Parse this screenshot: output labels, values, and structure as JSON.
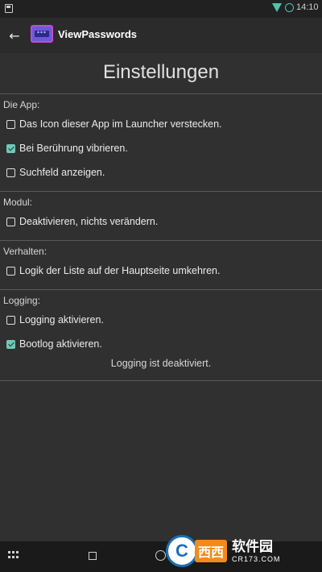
{
  "status_bar": {
    "time": "14:10",
    "icons": [
      "notification-icon",
      "wifi-icon",
      "sync-icon"
    ]
  },
  "app_bar": {
    "back_icon": "arrow-left-icon",
    "logo_icon": "password-app-logo-icon",
    "logo_text": "***",
    "title": "ViewPasswords"
  },
  "page": {
    "title": "Einstellungen"
  },
  "sections": {
    "app": {
      "label": "Die App:",
      "items": [
        {
          "label": "Das Icon dieser App im Launcher verstecken.",
          "checked": false
        },
        {
          "label": "Bei Berührung vibrieren.",
          "checked": true
        },
        {
          "label": "Suchfeld anzeigen.",
          "checked": false
        }
      ]
    },
    "modul": {
      "label": "Modul:",
      "items": [
        {
          "label": "Deaktivieren, nichts verändern.",
          "checked": false
        }
      ]
    },
    "verhalten": {
      "label": "Verhalten:",
      "items": [
        {
          "label": "Logik der Liste auf der Hauptseite umkehren.",
          "checked": false
        }
      ]
    },
    "logging": {
      "label": "Logging:",
      "items": [
        {
          "label": "Logging aktivieren.",
          "checked": false
        },
        {
          "label": "Bootlog aktivieren.",
          "checked": true
        }
      ],
      "status_text": "Logging ist deaktiviert."
    }
  },
  "nav_bar": {
    "icons": [
      "apps-grid-icon",
      "recents-square-icon",
      "home-circle-icon"
    ]
  },
  "watermark": {
    "letter": "C",
    "badge": "西西",
    "text": "软件园",
    "url": "CR173.COM"
  },
  "colors": {
    "background": "#303030",
    "accent": "#6fc8b8",
    "status_bar": "#212121",
    "nav_bar": "#1a1a1a"
  }
}
